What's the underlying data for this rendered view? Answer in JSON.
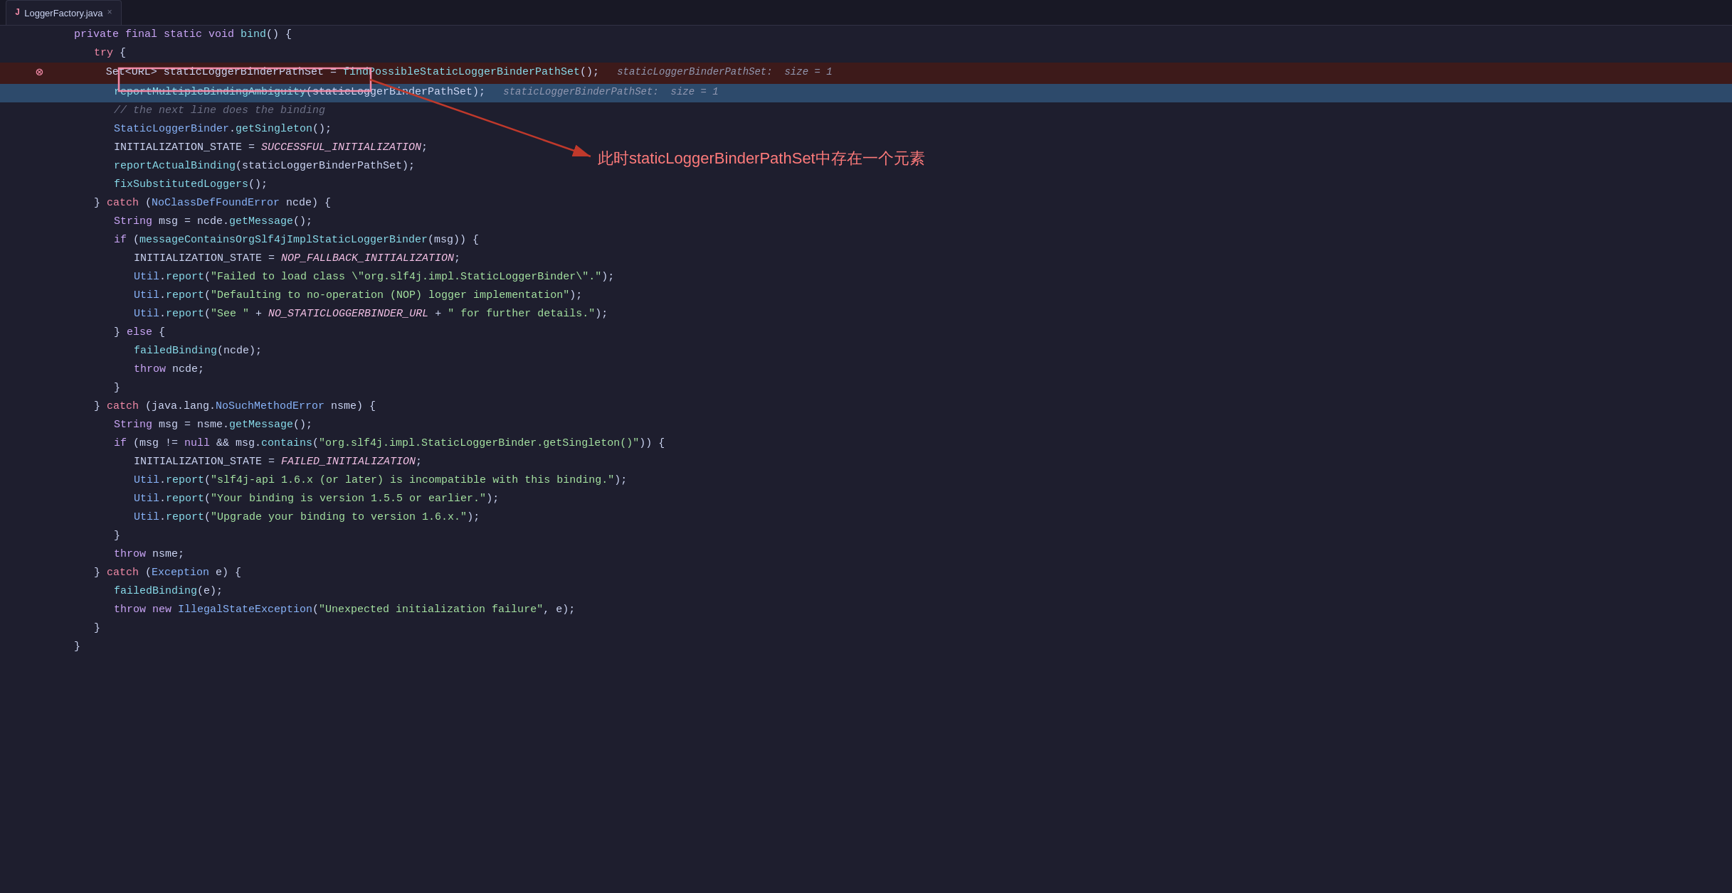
{
  "tab": {
    "name": "LoggerFactory.java",
    "close": "×"
  },
  "lines": [
    {
      "num": "",
      "indent": 1,
      "content": "private final static void bind() {",
      "type": "plain",
      "tokens": [
        {
          "t": "kw",
          "v": "private "
        },
        {
          "t": "kw",
          "v": "final "
        },
        {
          "t": "kw",
          "v": "static "
        },
        {
          "t": "kw",
          "v": "void "
        },
        {
          "t": "method",
          "v": "bind"
        },
        {
          "t": "plain",
          "v": "() {"
        }
      ]
    },
    {
      "num": "",
      "indent": 2,
      "content": "try {",
      "type": "plain",
      "tokens": [
        {
          "t": "kw-flow",
          "v": "try "
        },
        {
          "t": "plain",
          "v": "{"
        }
      ]
    },
    {
      "num": "",
      "indent": 3,
      "content": "Set<URL> staticLoggerBinderPathSet = findPossibleStaticLoggerBinderPathSet();   staticLoggerBinderPathSet:  size = 1",
      "type": "error-line",
      "tokens": [
        {
          "t": "redbox",
          "v": "Set<URL> staticLoggerBinderPathSet"
        },
        {
          "t": "plain",
          "v": " = "
        },
        {
          "t": "method",
          "v": "findPossibleStaticLoggerBinderPathSet"
        },
        {
          "t": "plain",
          "v": "();"
        },
        {
          "t": "hint",
          "v": "   staticLoggerBinderPathSet:  size = 1"
        }
      ]
    },
    {
      "num": "",
      "indent": 3,
      "content": "reportMultipleBindingAmbiguity(staticLoggerBinderPathSet);   staticLoggerBinderPathSet:  size = 1",
      "type": "selected-line",
      "tokens": [
        {
          "t": "method",
          "v": "reportMultipleBindingAmbiguity"
        },
        {
          "t": "plain",
          "v": "(staticLoggerBinderPathSet);"
        },
        {
          "t": "hint",
          "v": "   staticLoggerBinderPathSet:  size = 1"
        }
      ]
    },
    {
      "num": "",
      "indent": 3,
      "content": "// the next line does the binding",
      "type": "plain",
      "tokens": [
        {
          "t": "comment",
          "v": "// the next line does the binding"
        }
      ]
    },
    {
      "num": "",
      "indent": 3,
      "content": "StaticLoggerBinder.getSingleton();",
      "type": "plain",
      "tokens": [
        {
          "t": "type",
          "v": "StaticLoggerBinder"
        },
        {
          "t": "plain",
          "v": "."
        },
        {
          "t": "method",
          "v": "getSingleton"
        },
        {
          "t": "plain",
          "v": "();"
        }
      ]
    },
    {
      "num": "",
      "indent": 3,
      "content": "INITIALIZATION_STATE = SUCCESSFUL_INITIALIZATION;",
      "type": "plain",
      "tokens": [
        {
          "t": "plain",
          "v": "INITIALIZATION_STATE = "
        },
        {
          "t": "italic-val",
          "v": "SUCCESSFUL_INITIALIZATION"
        },
        {
          "t": "plain",
          "v": ";"
        }
      ]
    },
    {
      "num": "",
      "indent": 3,
      "content": "reportActualBinding(staticLoggerBinderPathSet);",
      "type": "plain",
      "tokens": [
        {
          "t": "method",
          "v": "reportActualBinding"
        },
        {
          "t": "plain",
          "v": "(staticLoggerBinderPathSet);"
        }
      ]
    },
    {
      "num": "",
      "indent": 3,
      "content": "fixSubstitutedLoggers();",
      "type": "plain",
      "tokens": [
        {
          "t": "method",
          "v": "fixSubstitutedLoggers"
        },
        {
          "t": "plain",
          "v": "();"
        }
      ]
    },
    {
      "num": "",
      "indent": 2,
      "content": "} catch (NoClassDefFoundError ncde) {",
      "type": "plain",
      "tokens": [
        {
          "t": "plain",
          "v": "} "
        },
        {
          "t": "kw-flow",
          "v": "catch "
        },
        {
          "t": "plain",
          "v": "("
        },
        {
          "t": "type",
          "v": "NoClassDefFoundError"
        },
        {
          "t": "plain",
          "v": " ncde) {"
        }
      ]
    },
    {
      "num": "",
      "indent": 3,
      "content": "String msg = ncde.getMessage();",
      "type": "plain",
      "tokens": [
        {
          "t": "kw",
          "v": "String "
        },
        {
          "t": "plain",
          "v": "msg = ncde."
        },
        {
          "t": "method",
          "v": "getMessage"
        },
        {
          "t": "plain",
          "v": "();"
        }
      ]
    },
    {
      "num": "",
      "indent": 3,
      "content": "if (messageContainsOrgSlf4jImplStaticLoggerBinder(msg)) {",
      "type": "plain",
      "tokens": [
        {
          "t": "kw",
          "v": "if "
        },
        {
          "t": "plain",
          "v": "("
        },
        {
          "t": "method",
          "v": "messageContainsOrgSlf4jImplStaticLoggerBinder"
        },
        {
          "t": "plain",
          "v": "(msg)) {"
        }
      ]
    },
    {
      "num": "",
      "indent": 4,
      "content": "INITIALIZATION_STATE = NOP_FALLBACK_INITIALIZATION;",
      "type": "plain",
      "tokens": [
        {
          "t": "plain",
          "v": "INITIALIZATION_STATE = "
        },
        {
          "t": "italic-val",
          "v": "NOP_FALLBACK_INITIALIZATION"
        },
        {
          "t": "plain",
          "v": ";"
        }
      ]
    },
    {
      "num": "",
      "indent": 4,
      "content": "Util.report(\"Failed to load class \\\"org.slf4j.impl.StaticLoggerBinder\\\".\");",
      "type": "plain",
      "tokens": [
        {
          "t": "type",
          "v": "Util"
        },
        {
          "t": "plain",
          "v": "."
        },
        {
          "t": "method",
          "v": "report"
        },
        {
          "t": "plain",
          "v": "("
        },
        {
          "t": "str",
          "v": "\"Failed to load class \\\"org.slf4j.impl.StaticLoggerBinder\\\".\""
        },
        {
          "t": "plain",
          "v": ");"
        }
      ]
    },
    {
      "num": "",
      "indent": 4,
      "content": "Util.report(\"Defaulting to no-operation (NOP) logger implementation\");",
      "type": "plain",
      "tokens": [
        {
          "t": "type",
          "v": "Util"
        },
        {
          "t": "plain",
          "v": "."
        },
        {
          "t": "method",
          "v": "report"
        },
        {
          "t": "plain",
          "v": "("
        },
        {
          "t": "str",
          "v": "\"Defaulting to no-operation (NOP) logger implementation\""
        },
        {
          "t": "plain",
          "v": ");"
        }
      ]
    },
    {
      "num": "",
      "indent": 4,
      "content": "Util.report(\"See \" + NO_STATICLOGGERBINDER_URL + \" for further details.\");",
      "type": "plain",
      "tokens": [
        {
          "t": "type",
          "v": "Util"
        },
        {
          "t": "plain",
          "v": "."
        },
        {
          "t": "method",
          "v": "report"
        },
        {
          "t": "plain",
          "v": "("
        },
        {
          "t": "str",
          "v": "\"See \""
        },
        {
          "t": "plain",
          "v": " + "
        },
        {
          "t": "italic-val",
          "v": "NO_STATICLOGGERBINDER_URL"
        },
        {
          "t": "plain",
          "v": " + "
        },
        {
          "t": "str",
          "v": "\" for further details.\""
        },
        {
          "t": "plain",
          "v": ");"
        }
      ]
    },
    {
      "num": "",
      "indent": 3,
      "content": "} else {",
      "type": "plain",
      "tokens": [
        {
          "t": "plain",
          "v": "} "
        },
        {
          "t": "kw",
          "v": "else "
        },
        {
          "t": "plain",
          "v": "{"
        }
      ]
    },
    {
      "num": "",
      "indent": 4,
      "content": "failedBinding(ncde);",
      "type": "plain",
      "tokens": [
        {
          "t": "method",
          "v": "failedBinding"
        },
        {
          "t": "plain",
          "v": "(ncde);"
        }
      ]
    },
    {
      "num": "",
      "indent": 4,
      "content": "throw ncde;",
      "type": "plain",
      "tokens": [
        {
          "t": "kw",
          "v": "throw "
        },
        {
          "t": "plain",
          "v": "ncde;"
        }
      ]
    },
    {
      "num": "",
      "indent": 3,
      "content": "}",
      "type": "plain",
      "tokens": [
        {
          "t": "plain",
          "v": "}"
        }
      ]
    },
    {
      "num": "",
      "indent": 2,
      "content": "} catch (java.lang.NoSuchMethodError nsme) {",
      "type": "plain",
      "tokens": [
        {
          "t": "plain",
          "v": "} "
        },
        {
          "t": "kw-flow",
          "v": "catch "
        },
        {
          "t": "plain",
          "v": "(java.lang."
        },
        {
          "t": "type",
          "v": "NoSuchMethodError"
        },
        {
          "t": "plain",
          "v": " nsme) {"
        }
      ]
    },
    {
      "num": "",
      "indent": 3,
      "content": "String msg = nsme.getMessage();",
      "type": "plain",
      "tokens": [
        {
          "t": "kw",
          "v": "String "
        },
        {
          "t": "plain",
          "v": "msg = nsme."
        },
        {
          "t": "method",
          "v": "getMessage"
        },
        {
          "t": "plain",
          "v": "();"
        }
      ]
    },
    {
      "num": "",
      "indent": 3,
      "content": "if (msg != null && msg.contains(\"org.slf4j.impl.StaticLoggerBinder.getSingleton()\")) {",
      "type": "plain",
      "tokens": [
        {
          "t": "kw",
          "v": "if "
        },
        {
          "t": "plain",
          "v": "(msg != "
        },
        {
          "t": "kw",
          "v": "null "
        },
        {
          "t": "plain",
          "v": "&& msg."
        },
        {
          "t": "method",
          "v": "contains"
        },
        {
          "t": "plain",
          "v": "("
        },
        {
          "t": "str",
          "v": "\"org.slf4j.impl.StaticLoggerBinder.getSingleton()\""
        },
        {
          "t": "plain",
          "v": ")) {"
        }
      ]
    },
    {
      "num": "",
      "indent": 4,
      "content": "INITIALIZATION_STATE = FAILED_INITIALIZATION;",
      "type": "plain",
      "tokens": [
        {
          "t": "plain",
          "v": "INITIALIZATION_STATE = "
        },
        {
          "t": "italic-val",
          "v": "FAILED_INITIALIZATION"
        },
        {
          "t": "plain",
          "v": ";"
        }
      ]
    },
    {
      "num": "",
      "indent": 4,
      "content": "Util.report(\"slf4j-api 1.6.x (or later) is incompatible with this binding.\");",
      "type": "plain",
      "tokens": [
        {
          "t": "type",
          "v": "Util"
        },
        {
          "t": "plain",
          "v": "."
        },
        {
          "t": "method",
          "v": "report"
        },
        {
          "t": "plain",
          "v": "("
        },
        {
          "t": "str",
          "v": "\"slf4j-api 1.6.x (or later) is incompatible with this binding.\""
        },
        {
          "t": "plain",
          "v": ");"
        }
      ]
    },
    {
      "num": "",
      "indent": 4,
      "content": "Util.report(\"Your binding is version 1.5.5 or earlier.\");",
      "type": "plain",
      "tokens": [
        {
          "t": "type",
          "v": "Util"
        },
        {
          "t": "plain",
          "v": "."
        },
        {
          "t": "method",
          "v": "report"
        },
        {
          "t": "plain",
          "v": "("
        },
        {
          "t": "str",
          "v": "\"Your binding is version 1.5.5 or earlier.\""
        },
        {
          "t": "plain",
          "v": ");"
        }
      ]
    },
    {
      "num": "",
      "indent": 4,
      "content": "Util.report(\"Upgrade your binding to version 1.6.x.\");",
      "type": "plain",
      "tokens": [
        {
          "t": "type",
          "v": "Util"
        },
        {
          "t": "plain",
          "v": "."
        },
        {
          "t": "method",
          "v": "report"
        },
        {
          "t": "plain",
          "v": "("
        },
        {
          "t": "str",
          "v": "\"Upgrade your binding to version 1.6.x.\""
        },
        {
          "t": "plain",
          "v": ");"
        }
      ]
    },
    {
      "num": "",
      "indent": 3,
      "content": "}",
      "type": "plain",
      "tokens": [
        {
          "t": "plain",
          "v": "}"
        }
      ]
    },
    {
      "num": "",
      "indent": 3,
      "content": "throw nsme;",
      "type": "plain",
      "tokens": [
        {
          "t": "kw",
          "v": "throw "
        },
        {
          "t": "plain",
          "v": "nsme;"
        }
      ]
    },
    {
      "num": "",
      "indent": 2,
      "content": "} catch (Exception e) {",
      "type": "plain",
      "tokens": [
        {
          "t": "plain",
          "v": "} "
        },
        {
          "t": "kw-flow",
          "v": "catch "
        },
        {
          "t": "plain",
          "v": "("
        },
        {
          "t": "type",
          "v": "Exception"
        },
        {
          "t": "plain",
          "v": " e) {"
        }
      ]
    },
    {
      "num": "",
      "indent": 3,
      "content": "failedBinding(e);",
      "type": "plain",
      "tokens": [
        {
          "t": "method",
          "v": "failedBinding"
        },
        {
          "t": "plain",
          "v": "(e);"
        }
      ]
    },
    {
      "num": "",
      "indent": 3,
      "content": "throw new IllegalStateException(\"Unexpected initialization failure\", e);",
      "type": "plain",
      "tokens": [
        {
          "t": "kw",
          "v": "throw "
        },
        {
          "t": "kw",
          "v": "new "
        },
        {
          "t": "type",
          "v": "IllegalStateException"
        },
        {
          "t": "plain",
          "v": "("
        },
        {
          "t": "str",
          "v": "\"Unexpected initialization failure\""
        },
        {
          "t": "plain",
          "v": ", e);"
        }
      ]
    },
    {
      "num": "",
      "indent": 2,
      "content": "}",
      "type": "plain",
      "tokens": [
        {
          "t": "plain",
          "v": "}"
        }
      ]
    },
    {
      "num": "",
      "indent": 1,
      "content": "}",
      "type": "plain",
      "tokens": [
        {
          "t": "plain",
          "v": "}"
        }
      ]
    }
  ],
  "annotation": {
    "chinese_text": "此时staticLoggerBinderPathSet中存在一个元素"
  },
  "colors": {
    "bg": "#1e1e2e",
    "tab_bg": "#1e1e2e",
    "error_line_bg": "#3d1a1a",
    "selected_line_bg": "#2d4a6b",
    "error_dot": "#f38ba8",
    "red_box_border": "#f38ba8",
    "arrow_color": "#c0392b"
  }
}
